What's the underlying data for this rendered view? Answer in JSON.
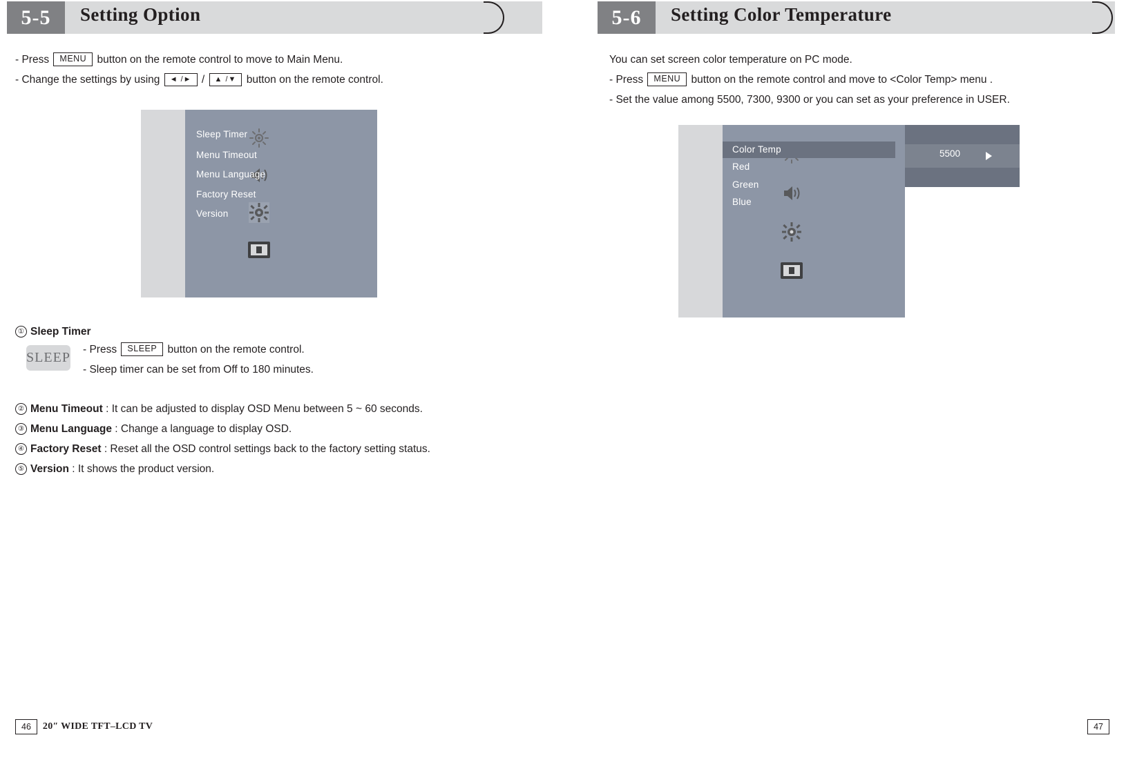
{
  "left_page": {
    "header": {
      "number": "5-5",
      "title": "Setting Option"
    },
    "intro_lines": [
      {
        "pre": "- Press ",
        "key": "MENU",
        "post": " button on the remote control to move to Main Menu."
      },
      {
        "pre": "- Change the settings by using ",
        "key1": "◄ /►",
        "mid": " / ",
        "key2": "▲ /▼",
        "post": " button on the remote control."
      }
    ],
    "osd": {
      "items": [
        "Sleep Timer",
        "Menu Timeout",
        "Menu Language",
        "Factory Reset",
        "Version"
      ],
      "icons": [
        "sun-icon",
        "speaker-icon",
        "gear-icon",
        "monitor-icon"
      ],
      "selected_icon_index": 2
    },
    "numbered": [
      {
        "num": "①",
        "label": "Sleep Timer",
        "desc": ""
      },
      {
        "num": "②",
        "label": "Menu Timeout",
        "desc": " : It can be adjusted to display OSD Menu between 5 ~ 60 seconds."
      },
      {
        "num": "③",
        "label": "Menu Language",
        "desc": " : Change a language to display OSD."
      },
      {
        "num": "④",
        "label": "Factory Reset",
        "desc": " : Reset all the OSD control settings back to the factory setting status."
      },
      {
        "num": "⑤",
        "label": "Version",
        "desc": " : It shows the product version."
      }
    ],
    "sleep_button_label": "SLEEP",
    "sleep_lines": [
      {
        "pre": "- Press ",
        "key": "SLEEP",
        "post": " button on the remote control."
      },
      {
        "pre": "- Sleep timer can be set from Off to 180 minutes.",
        "key": "",
        "post": ""
      }
    ],
    "footer": {
      "page": "46",
      "model": "20″ WIDE TFT–LCD TV"
    }
  },
  "right_page": {
    "header": {
      "number": "5-6",
      "title": "Setting Color Temperature"
    },
    "intro_lines": [
      {
        "pre": "You can set screen color temperature on PC mode.",
        "key": "",
        "post": ""
      },
      {
        "pre": "- Press ",
        "key": "MENU",
        "post": " button on the remote control and move to <Color Temp> menu ."
      },
      {
        "pre": "- Set the value among 5500, 7300, 9300 or you can set as your preference in USER.",
        "key": "",
        "post": ""
      }
    ],
    "osd": {
      "items": [
        "Color Temp",
        "Red",
        "Green",
        "Blue"
      ],
      "highlight_index": 0,
      "value": "5500",
      "icons": [
        "sun-icon",
        "speaker-icon",
        "gear-icon",
        "monitor-icon"
      ]
    },
    "footer": {
      "page": "47"
    }
  }
}
